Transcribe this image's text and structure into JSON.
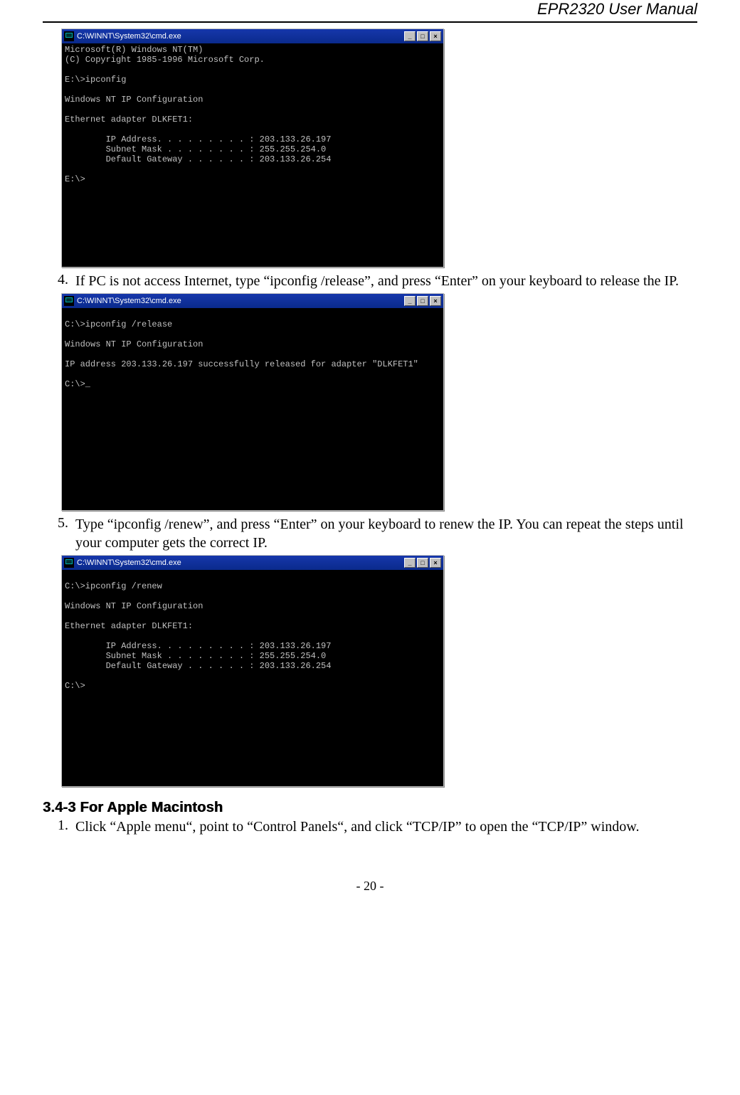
{
  "header": {
    "product": "EPR2320",
    "suffix": " User Manual"
  },
  "consoles": {
    "c1": {
      "title": "C:\\WINNT\\System32\\cmd.exe",
      "body": "Microsoft(R) Windows NT(TM)\n(C) Copyright 1985-1996 Microsoft Corp.\n\nE:\\>ipconfig\n\nWindows NT IP Configuration\n\nEthernet adapter DLKFET1:\n\n        IP Address. . . . . . . . . : 203.133.26.197\n        Subnet Mask . . . . . . . . : 255.255.254.0\n        Default Gateway . . . . . . : 203.133.26.254\n\nE:\\>"
    },
    "c2": {
      "title": "C:\\WINNT\\System32\\cmd.exe",
      "body": "\nC:\\>ipconfig /release\n\nWindows NT IP Configuration\n\nIP address 203.133.26.197 successfully released for adapter \"DLKFET1\"\n\nC:\\>_"
    },
    "c3": {
      "title": "C:\\WINNT\\System32\\cmd.exe",
      "body": "\nC:\\>ipconfig /renew\n\nWindows NT IP Configuration\n\nEthernet adapter DLKFET1:\n\n        IP Address. . . . . . . . . : 203.133.26.197\n        Subnet Mask . . . . . . . . : 255.255.254.0\n        Default Gateway . . . . . . : 203.133.26.254\n\nC:\\>"
    }
  },
  "steps": {
    "s4": {
      "num": "4.",
      "text": "If PC is not access Internet, type “ipconfig /release”, and press “Enter” on your keyboard to release the IP."
    },
    "s5": {
      "num": "5.",
      "text": "Type “ipconfig /renew”, and press “Enter” on your keyboard to renew the IP. You can repeat the steps until your computer gets the correct IP."
    },
    "mac1": {
      "num": "1.",
      "text": "Click “Apple menu“, point to “Control Panels“, and click “TCP/IP” to open the “TCP/IP” window."
    }
  },
  "section_heading": "3.4-3 For Apple Macintosh",
  "footer": "- 20 -",
  "win_buttons": {
    "min": "_",
    "max": "□",
    "close": "×"
  }
}
